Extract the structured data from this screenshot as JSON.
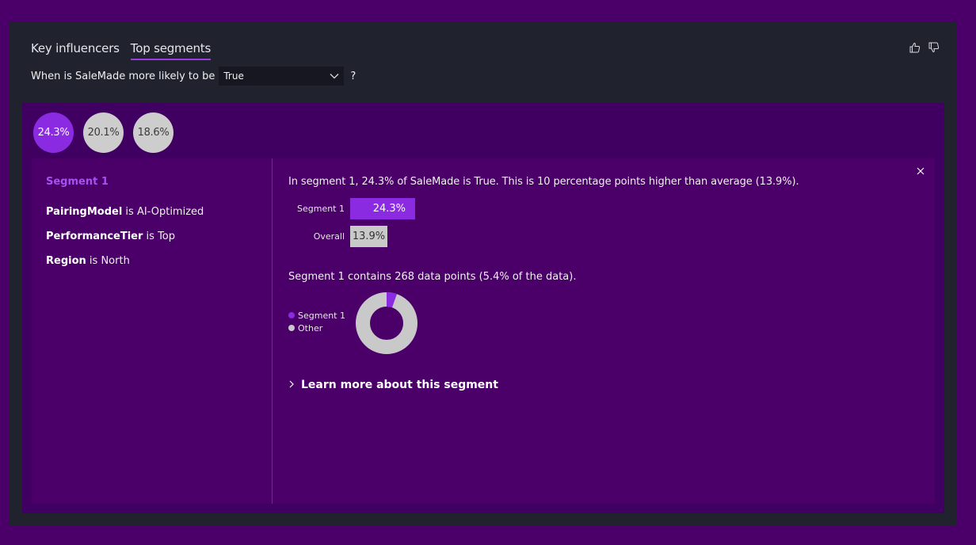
{
  "tabs": [
    {
      "label": "Key influencers",
      "active": false
    },
    {
      "label": "Top segments",
      "active": true
    }
  ],
  "icons": {
    "thumbs_up": "thumbs-up-icon",
    "thumbs_down": "thumbs-down-icon",
    "close": "close-icon",
    "chevron": "chevron-right-icon"
  },
  "question": {
    "prefix": "When is SaleMade more likely to be",
    "selected_value": "True",
    "suffix": "?"
  },
  "segments": [
    {
      "label": "24.3%",
      "selected": true
    },
    {
      "label": "20.1%",
      "selected": false
    },
    {
      "label": "18.6%",
      "selected": false
    }
  ],
  "detail": {
    "title": "Segment 1",
    "conditions": [
      {
        "field": "PairingModel",
        "op": "is",
        "value": "AI-Optimized"
      },
      {
        "field": "PerformanceTier",
        "op": "is",
        "value": "Top"
      },
      {
        "field": "Region",
        "op": "is",
        "value": "North"
      }
    ],
    "statement": "In segment 1, 24.3% of SaleMade is True. This is 10 percentage points higher than average (13.9%).",
    "contains": "Segment 1 contains 268 data points (5.4% of the data).",
    "learn_more": "Learn more about this segment"
  },
  "colors": {
    "accent": "#8a2be2",
    "neutral": "#c9c9c9",
    "background": "#4a0068",
    "card": "#20222e"
  },
  "chart_data": [
    {
      "type": "bar",
      "categories": [
        "Segment 1",
        "Overall"
      ],
      "values": [
        24.3,
        13.9
      ],
      "value_labels": [
        "24.3%",
        "13.9%"
      ],
      "colors": [
        "#8a2be2",
        "#c9c9c9"
      ]
    },
    {
      "type": "pie",
      "style": "donut",
      "categories": [
        "Segment 1",
        "Other"
      ],
      "values": [
        5.4,
        94.6
      ],
      "colors": [
        "#8a2be2",
        "#c9c9c9"
      ]
    }
  ]
}
